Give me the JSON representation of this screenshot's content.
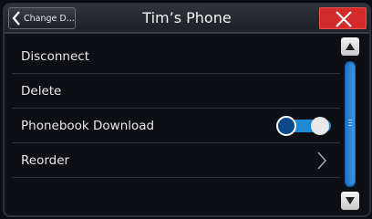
{
  "header": {
    "back_label": "Change D...",
    "title": "Tim’s Phone"
  },
  "list": {
    "items": [
      {
        "label": "Disconnect"
      },
      {
        "label": "Delete"
      },
      {
        "label": "Phonebook Download",
        "toggle_on": true
      },
      {
        "label": "Reorder"
      }
    ]
  },
  "colors": {
    "accent": "#1f8bd6",
    "close": "#d52a2a"
  },
  "icons": {
    "back": "chevron-left-icon",
    "close": "close-icon",
    "row_arrow": "chevron-right-icon",
    "scroll_up": "triangle-up-icon",
    "scroll_down": "triangle-down-icon"
  }
}
